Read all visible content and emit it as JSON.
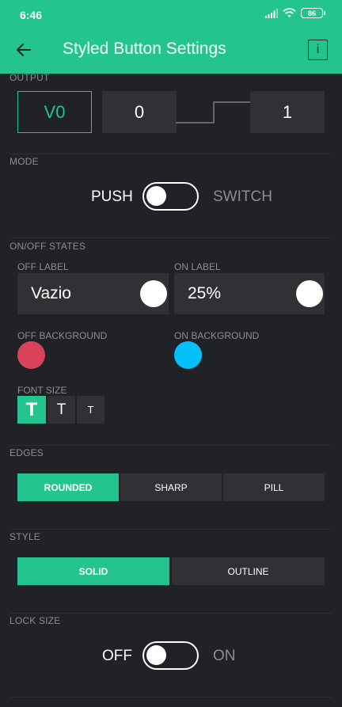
{
  "status_bar": {
    "time": "6:46",
    "battery": "86"
  },
  "header": {
    "title": "Styled Button Settings",
    "info_icon": "i"
  },
  "output": {
    "section_label": "OUTPUT",
    "pin": "V0",
    "range_min": "0",
    "range_max": "1"
  },
  "mode": {
    "section_label": "MODE",
    "left_label": "PUSH",
    "right_label": "SWITCH"
  },
  "states": {
    "section_label": "ON/OFF STATES",
    "off_label_title": "OFF LABEL",
    "off_label_value": "Vazio",
    "on_label_title": "ON LABEL",
    "on_label_value": "25%",
    "off_background_title": "OFF BACKGROUND",
    "on_background_title": "ON BACKGROUND",
    "off_color": "#d9435a",
    "on_color": "#04c0f8"
  },
  "font_size": {
    "title": "FONT SIZE",
    "options": [
      "T",
      "T",
      "T"
    ],
    "selected_index": 0
  },
  "edges": {
    "section_label": "EDGES",
    "options": [
      "ROUNDED",
      "SHARP",
      "PILL"
    ],
    "selected_index": 0
  },
  "style": {
    "section_label": "STYLE",
    "options": [
      "SOLID",
      "OUTLINE"
    ],
    "selected_index": 0
  },
  "lock_size": {
    "section_label": "LOCK SIZE",
    "left_label": "OFF",
    "right_label": "ON"
  },
  "colors": {
    "accent": "#23c48e",
    "background": "#212227",
    "field": "#2f3135"
  }
}
